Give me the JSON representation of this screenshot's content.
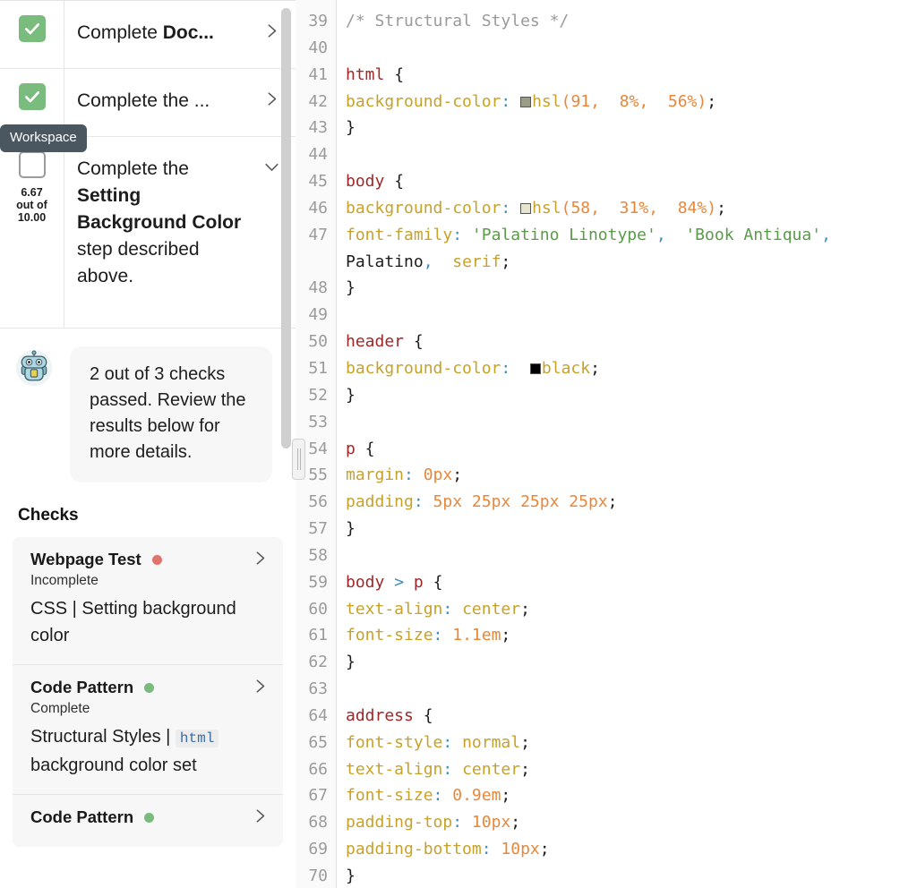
{
  "sidebar": {
    "tooltip": "Workspace",
    "score": {
      "value": "6.67",
      "middle": "out of",
      "max": "10.00"
    },
    "tasks": [
      {
        "id": "task-1",
        "state": "complete",
        "text_plain": "Complete ",
        "text_bold": "Doc...",
        "chevron": "chevron-right-icon"
      },
      {
        "id": "task-2",
        "state": "complete",
        "text_plain": "Complete the ...",
        "text_bold": "",
        "chevron": "chevron-right-icon"
      },
      {
        "id": "task-3",
        "state": "incomplete",
        "text_lead": "Complete the ",
        "text_bold": "Setting Background Color",
        "text_tail": " step described above.",
        "chevron": "chevron-down-icon"
      }
    ],
    "assistant": {
      "avatar": "robot-avatar-icon",
      "message": "2 out of 3 checks passed. Review the results below for more details."
    },
    "checks_heading": "Checks",
    "checks": [
      {
        "name": "Webpage Test",
        "dot": "red",
        "status": "Incomplete",
        "desc_pre": "CSS | Setting background color",
        "desc_code": "",
        "desc_post": "",
        "chevron": "chevron-right-icon"
      },
      {
        "name": "Code Pattern",
        "dot": "green",
        "status": "Complete",
        "desc_pre": "Structural Styles | ",
        "desc_code": "html",
        "desc_post": " background color set",
        "chevron": "chevron-right-icon"
      },
      {
        "name": "Code Pattern",
        "dot": "green",
        "status": "",
        "desc_pre": "",
        "desc_code": "",
        "desc_post": "",
        "chevron": "chevron-right-icon"
      }
    ],
    "colors": {
      "complete_green": "#7abb7e",
      "status_red": "#e0736d",
      "status_green": "#78bb7c",
      "tooltip_bg": "#4a5660"
    }
  },
  "editor": {
    "first_line": 39,
    "last_line": 70,
    "lines": [
      {
        "n": 39,
        "tokens": [
          {
            "t": "/* Structural Styles */",
            "c": "cm"
          }
        ]
      },
      {
        "n": 40,
        "tokens": []
      },
      {
        "n": 41,
        "tokens": [
          {
            "t": "html",
            "c": "sel"
          },
          {
            "t": " {",
            "c": "pl"
          }
        ]
      },
      {
        "n": 42,
        "tokens": [
          {
            "t": "background-color",
            "c": "prop"
          },
          {
            "t": ":",
            "c": "col"
          },
          {
            "t": " ",
            "c": "pl"
          },
          {
            "t": "swatch",
            "c": "sw",
            "sw": "#9a9c85"
          },
          {
            "t": "hsl",
            "c": "fn"
          },
          {
            "t": "(",
            "c": "num"
          },
          {
            "t": "91",
            "c": "num"
          },
          {
            "t": ",",
            "c": "num"
          },
          {
            "t": "  ",
            "c": "pl"
          },
          {
            "t": "8%",
            "c": "num"
          },
          {
            "t": ",",
            "c": "num"
          },
          {
            "t": "  ",
            "c": "pl"
          },
          {
            "t": "56%",
            "c": "num"
          },
          {
            "t": ")",
            "c": "num"
          },
          {
            "t": ";",
            "c": "pl"
          }
        ]
      },
      {
        "n": 43,
        "tokens": [
          {
            "t": "}",
            "c": "pl"
          }
        ]
      },
      {
        "n": 44,
        "tokens": []
      },
      {
        "n": 45,
        "tokens": [
          {
            "t": "body",
            "c": "sel"
          },
          {
            "t": " {",
            "c": "pl"
          }
        ]
      },
      {
        "n": 46,
        "tokens": [
          {
            "t": "background-color",
            "c": "prop"
          },
          {
            "t": ":",
            "c": "col"
          },
          {
            "t": " ",
            "c": "pl"
          },
          {
            "t": "swatch",
            "c": "sw",
            "sw": "#e6e5cd"
          },
          {
            "t": "hsl",
            "c": "fn"
          },
          {
            "t": "(",
            "c": "num"
          },
          {
            "t": "58",
            "c": "num"
          },
          {
            "t": ",",
            "c": "num"
          },
          {
            "t": "  ",
            "c": "pl"
          },
          {
            "t": "31%",
            "c": "num"
          },
          {
            "t": ",",
            "c": "num"
          },
          {
            "t": "  ",
            "c": "pl"
          },
          {
            "t": "84%",
            "c": "num"
          },
          {
            "t": ")",
            "c": "num"
          },
          {
            "t": ";",
            "c": "pl"
          }
        ]
      },
      {
        "n": 47,
        "tokens": [
          {
            "t": "font-family",
            "c": "prop"
          },
          {
            "t": ":",
            "c": "col"
          },
          {
            "t": " ",
            "c": "pl"
          },
          {
            "t": "'Palatino Linotype'",
            "c": "str"
          },
          {
            "t": ",",
            "c": "col"
          },
          {
            "t": "  ",
            "c": "pl"
          },
          {
            "t": "'Book Antiqua'",
            "c": "str"
          },
          {
            "t": ",",
            "c": "col"
          },
          {
            "t": " ",
            "c": "pl"
          },
          {
            "t": "Palatino",
            "c": "pl"
          },
          {
            "t": ",",
            "c": "col"
          },
          {
            "t": "  ",
            "c": "pl"
          },
          {
            "t": "serif",
            "c": "fn"
          },
          {
            "t": ";",
            "c": "pl"
          }
        ]
      },
      {
        "n": 48,
        "tokens": [
          {
            "t": "}",
            "c": "pl"
          }
        ]
      },
      {
        "n": 49,
        "tokens": []
      },
      {
        "n": 50,
        "tokens": [
          {
            "t": "header",
            "c": "sel"
          },
          {
            "t": " {",
            "c": "pl"
          }
        ]
      },
      {
        "n": 51,
        "tokens": [
          {
            "t": "background-color",
            "c": "prop"
          },
          {
            "t": ":",
            "c": "col"
          },
          {
            "t": "  ",
            "c": "pl"
          },
          {
            "t": "swatch",
            "c": "sw",
            "sw": "#000000"
          },
          {
            "t": "black",
            "c": "fn"
          },
          {
            "t": ";",
            "c": "pl"
          }
        ]
      },
      {
        "n": 52,
        "tokens": [
          {
            "t": "}",
            "c": "pl"
          }
        ]
      },
      {
        "n": 53,
        "tokens": []
      },
      {
        "n": 54,
        "tokens": [
          {
            "t": "p",
            "c": "sel"
          },
          {
            "t": " {",
            "c": "pl"
          }
        ]
      },
      {
        "n": 55,
        "tokens": [
          {
            "t": "margin",
            "c": "prop"
          },
          {
            "t": ":",
            "c": "col"
          },
          {
            "t": " ",
            "c": "pl"
          },
          {
            "t": "0px",
            "c": "num"
          },
          {
            "t": ";",
            "c": "pl"
          }
        ]
      },
      {
        "n": 56,
        "tokens": [
          {
            "t": "padding",
            "c": "prop"
          },
          {
            "t": ":",
            "c": "col"
          },
          {
            "t": " ",
            "c": "pl"
          },
          {
            "t": "5px 25px 25px 25px",
            "c": "num"
          },
          {
            "t": ";",
            "c": "pl"
          }
        ]
      },
      {
        "n": 57,
        "tokens": [
          {
            "t": "}",
            "c": "pl"
          }
        ]
      },
      {
        "n": 58,
        "tokens": []
      },
      {
        "n": 59,
        "tokens": [
          {
            "t": "body",
            "c": "sel"
          },
          {
            "t": " ",
            "c": "pl"
          },
          {
            "t": ">",
            "c": "col"
          },
          {
            "t": " ",
            "c": "pl"
          },
          {
            "t": "p",
            "c": "sel"
          },
          {
            "t": " {",
            "c": "pl"
          }
        ]
      },
      {
        "n": 60,
        "tokens": [
          {
            "t": "text-align",
            "c": "prop"
          },
          {
            "t": ":",
            "c": "col"
          },
          {
            "t": " ",
            "c": "pl"
          },
          {
            "t": "center",
            "c": "fn"
          },
          {
            "t": ";",
            "c": "pl"
          }
        ]
      },
      {
        "n": 61,
        "tokens": [
          {
            "t": "font-size",
            "c": "prop"
          },
          {
            "t": ":",
            "c": "col"
          },
          {
            "t": " ",
            "c": "pl"
          },
          {
            "t": "1.1em",
            "c": "num"
          },
          {
            "t": ";",
            "c": "pl"
          }
        ]
      },
      {
        "n": 62,
        "tokens": [
          {
            "t": "}",
            "c": "pl"
          }
        ]
      },
      {
        "n": 63,
        "tokens": []
      },
      {
        "n": 64,
        "tokens": [
          {
            "t": "address",
            "c": "sel"
          },
          {
            "t": " {",
            "c": "pl"
          }
        ]
      },
      {
        "n": 65,
        "tokens": [
          {
            "t": "font-style",
            "c": "prop"
          },
          {
            "t": ":",
            "c": "col"
          },
          {
            "t": " ",
            "c": "pl"
          },
          {
            "t": "normal",
            "c": "fn"
          },
          {
            "t": ";",
            "c": "pl"
          }
        ]
      },
      {
        "n": 66,
        "tokens": [
          {
            "t": "text-align",
            "c": "prop"
          },
          {
            "t": ":",
            "c": "col"
          },
          {
            "t": " ",
            "c": "pl"
          },
          {
            "t": "center",
            "c": "fn"
          },
          {
            "t": ";",
            "c": "pl"
          }
        ]
      },
      {
        "n": 67,
        "tokens": [
          {
            "t": "font-size",
            "c": "prop"
          },
          {
            "t": ":",
            "c": "col"
          },
          {
            "t": " ",
            "c": "pl"
          },
          {
            "t": "0.9em",
            "c": "num"
          },
          {
            "t": ";",
            "c": "pl"
          }
        ]
      },
      {
        "n": 68,
        "tokens": [
          {
            "t": "padding-top",
            "c": "prop"
          },
          {
            "t": ":",
            "c": "col"
          },
          {
            "t": " ",
            "c": "pl"
          },
          {
            "t": "10px",
            "c": "num"
          },
          {
            "t": ";",
            "c": "pl"
          }
        ]
      },
      {
        "n": 69,
        "tokens": [
          {
            "t": "padding-bottom",
            "c": "prop"
          },
          {
            "t": ":",
            "c": "col"
          },
          {
            "t": " ",
            "c": "pl"
          },
          {
            "t": "10px",
            "c": "num"
          },
          {
            "t": ";",
            "c": "pl"
          }
        ]
      },
      {
        "n": 70,
        "tokens": [
          {
            "t": "}",
            "c": "pl"
          }
        ]
      }
    ]
  }
}
